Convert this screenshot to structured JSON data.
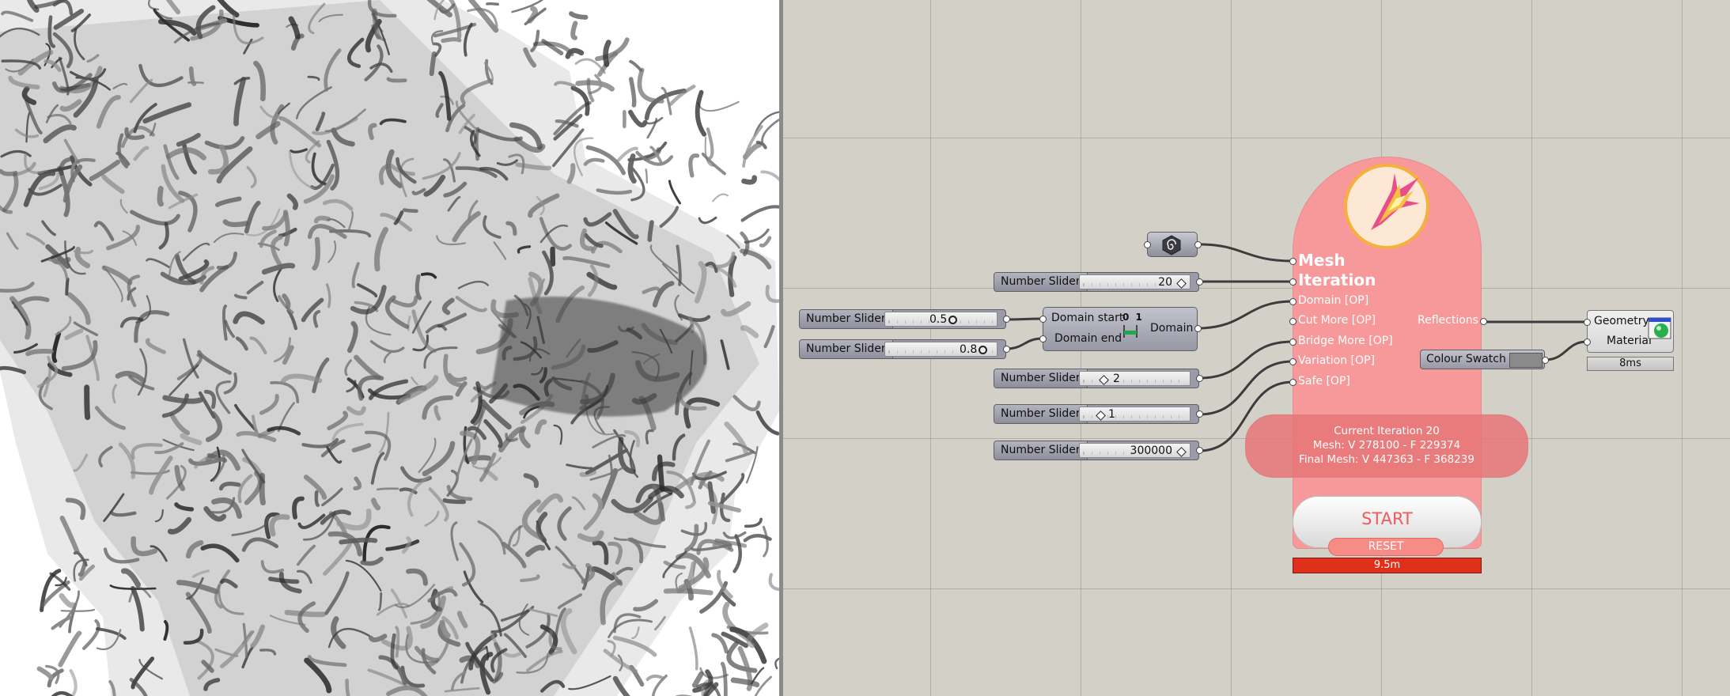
{
  "viewport": {
    "description_none": ""
  },
  "sliders": [
    {
      "label": "Number Slider",
      "value": "20"
    },
    {
      "label": "Number Slider",
      "value": "0.5"
    },
    {
      "label": "Number Slider",
      "value": "0.8"
    },
    {
      "label": "Number Slider",
      "value": "2"
    },
    {
      "label": "Number Slider",
      "value": "1"
    },
    {
      "label": "Number Slider",
      "value": "300000"
    }
  ],
  "domain": {
    "start_label": "Domain start",
    "end_label": "Domain end",
    "output_label": "Domain",
    "icon_text": "0 1"
  },
  "mesh": {
    "title_line1": "Mesh",
    "title_line2": "Iteration",
    "inputs": [
      "Domain [OP]",
      "Cut More [OP]",
      "Bridge More [OP]",
      "Variation [OP]",
      "Safe [OP]"
    ],
    "output": "Reflections",
    "status": [
      "Current Iteration 20",
      "Mesh: V 278100 - F 229374",
      "Final Mesh: V 447363 - F 368239"
    ],
    "start_label": "START",
    "reset_label": "RESET",
    "timer": "9.5m"
  },
  "geometry": {
    "geometry_label": "Geometry",
    "material_label": "Material",
    "timer": "8ms"
  },
  "swatch": {
    "label": "Colour Swatch"
  },
  "colors": {
    "canvas": "#d3d0c8",
    "mesh_component": "#f7999a",
    "timer_bar": "#e0301c",
    "start_text": "#f05a5a"
  }
}
